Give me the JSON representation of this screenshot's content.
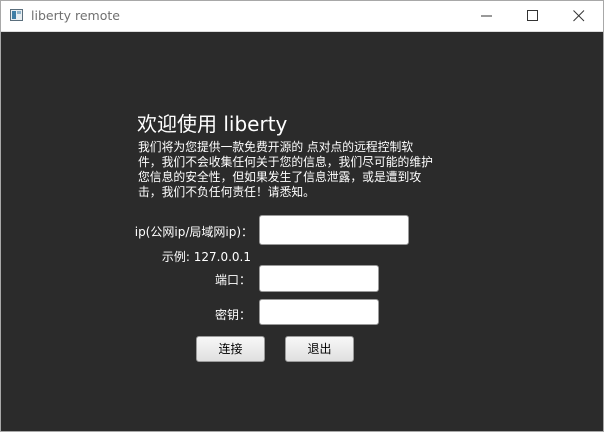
{
  "window": {
    "title": "liberty remote",
    "controls": {
      "minimize_icon": "minimize-icon",
      "maximize_icon": "maximize-icon",
      "close_icon": "close-icon"
    }
  },
  "main": {
    "welcome": "欢迎使用 liberty",
    "description": "我们将为您提供一款免费开源的 点对点的远程控制软件，我们不会收集任何关于您的信息，我们尽可能的维护您信息的安全性，但如果发生了信息泄露，或是遭到攻击，我们不负任何责任！请悉知。",
    "ip_label": "ip(公网ip/局域网ip)：",
    "ip_value": "",
    "example": "示例: 127.0.0.1",
    "port_label": "端口：",
    "port_value": "",
    "secret_label": "密钥：",
    "secret_value": "",
    "connect_button": "连接",
    "exit_button": "退出"
  },
  "colors": {
    "background": "#2b2b2b",
    "titlebar": "#ffffff",
    "text": "#ffffff"
  }
}
